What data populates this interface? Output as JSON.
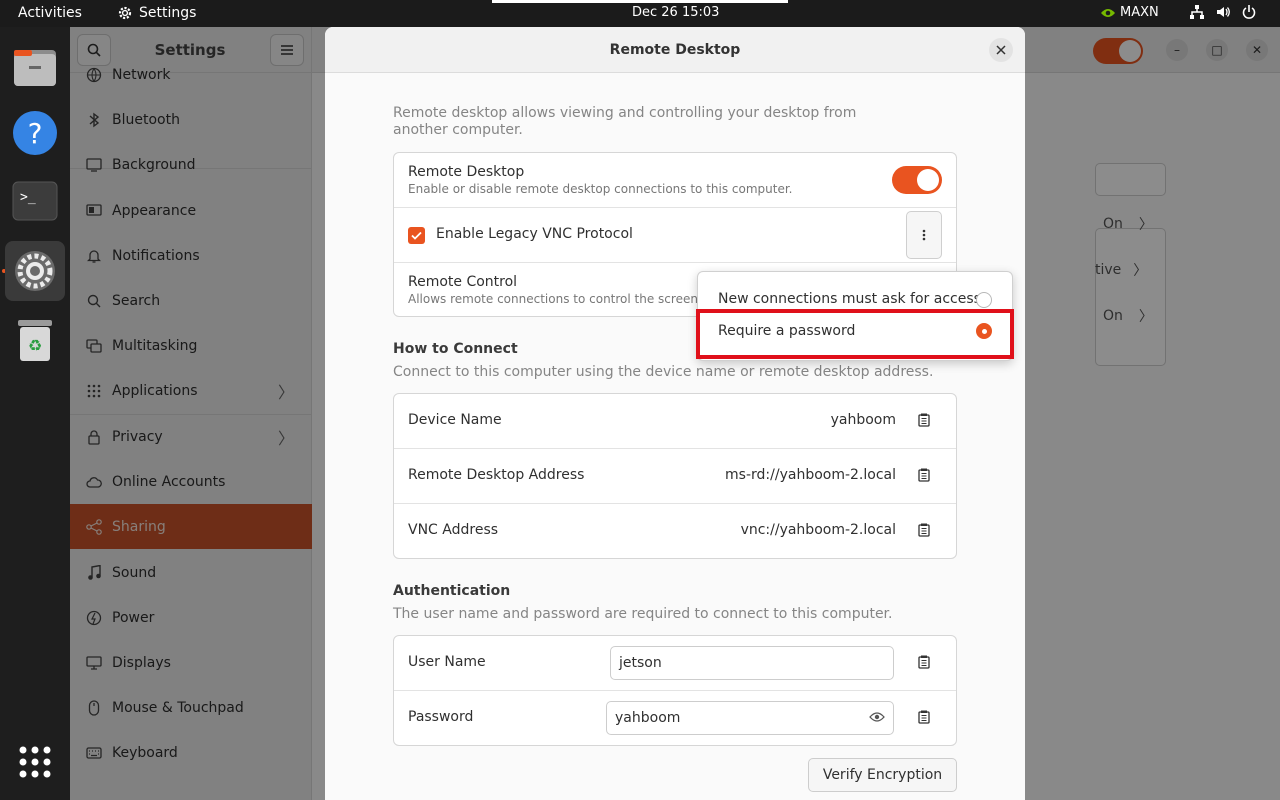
{
  "topbar": {
    "activities": "Activities",
    "app_name": "Settings",
    "datetime": "Dec 26  15:03",
    "nvidia_label": "MAXN"
  },
  "dock": {
    "items": [
      "files-icon",
      "help-icon",
      "terminal-icon",
      "settings-icon",
      "trash-icon",
      "app-grid-icon"
    ]
  },
  "sidebar": {
    "title": "Settings",
    "items": [
      {
        "label": "Network",
        "icon": "network-icon"
      },
      {
        "label": "Bluetooth",
        "icon": "bluetooth-icon"
      },
      {
        "label": "Background",
        "icon": "background-icon"
      },
      {
        "label": "Appearance",
        "icon": "appearance-icon"
      },
      {
        "label": "Notifications",
        "icon": "bell-icon"
      },
      {
        "label": "Search",
        "icon": "search-icon"
      },
      {
        "label": "Multitasking",
        "icon": "multitasking-icon"
      },
      {
        "label": "Applications",
        "icon": "grid-icon",
        "chevron": true
      },
      {
        "label": "Privacy",
        "icon": "lock-icon",
        "chevron": true
      },
      {
        "label": "Online Accounts",
        "icon": "cloud-icon"
      },
      {
        "label": "Sharing",
        "icon": "share-icon",
        "selected": true
      },
      {
        "label": "Sound",
        "icon": "music-note-icon"
      },
      {
        "label": "Power",
        "icon": "power-icon"
      },
      {
        "label": "Displays",
        "icon": "display-icon"
      },
      {
        "label": "Mouse & Touchpad",
        "icon": "mouse-icon"
      },
      {
        "label": "Keyboard",
        "icon": "keyboard-icon"
      }
    ]
  },
  "background_panel": {
    "rows": [
      "On",
      "tive",
      "On"
    ]
  },
  "dialog": {
    "title": "Remote Desktop",
    "intro": "Remote desktop allows viewing and controlling your desktop from another computer.",
    "remote_desktop": {
      "label": "Remote Desktop",
      "sub": "Enable or disable remote desktop connections to this computer.",
      "enabled": true
    },
    "legacy_vnc": {
      "label": "Enable Legacy VNC Protocol",
      "checked": true
    },
    "remote_control": {
      "label": "Remote Control",
      "sub": "Allows remote connections to control the screen."
    },
    "how_to_connect": {
      "title": "How to Connect",
      "desc": "Connect to this computer using the device name or remote desktop address.",
      "rows": [
        {
          "label": "Device Name",
          "value": "yahboom"
        },
        {
          "label": "Remote Desktop Address",
          "value": "ms-rd://yahboom-2.local"
        },
        {
          "label": "VNC Address",
          "value": "vnc://yahboom-2.local"
        }
      ]
    },
    "authentication": {
      "title": "Authentication",
      "desc": "The user name and password are required to connect to this computer.",
      "user_label": "User Name",
      "user_value": "jetson",
      "password_label": "Password",
      "password_value": "yahboom"
    },
    "verify_button": "Verify Encryption"
  },
  "popover": {
    "options": [
      {
        "label": "New connections must ask for access",
        "selected": false
      },
      {
        "label": "Require a password",
        "selected": true
      }
    ]
  },
  "colors": {
    "accent": "#e95420",
    "highlight": "#e0101a"
  }
}
